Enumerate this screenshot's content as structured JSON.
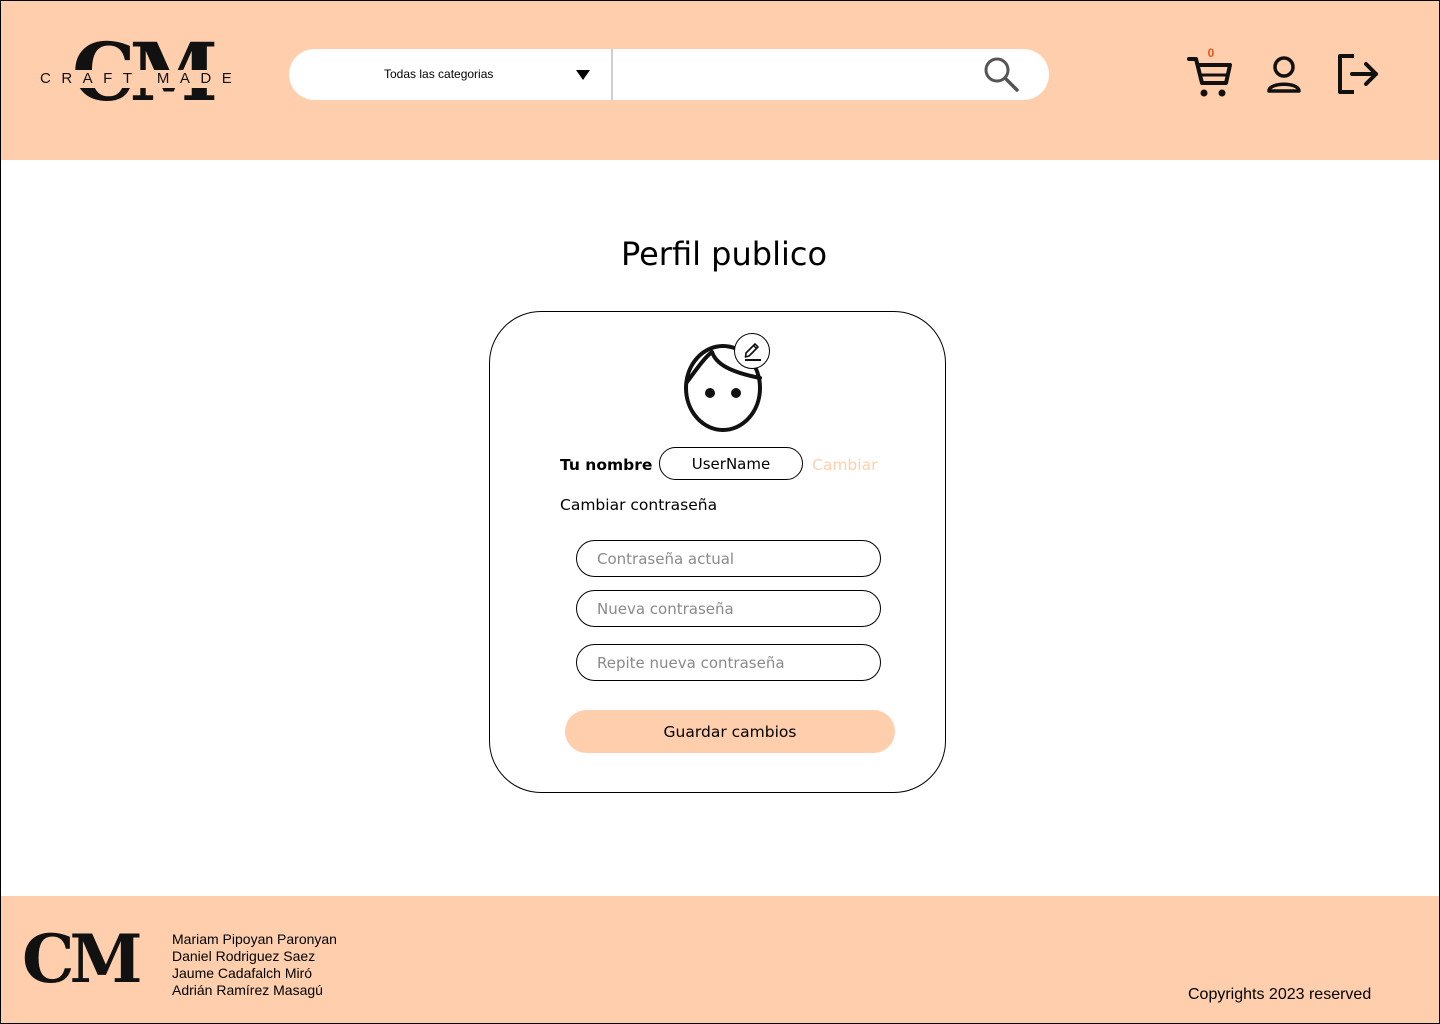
{
  "header": {
    "logo": {
      "monogram": "CM",
      "wordmark": "CRAFT MADE"
    },
    "search": {
      "category_label": "Todas las categorias",
      "placeholder": ""
    },
    "cart_count": "0",
    "icons": [
      "cart-icon",
      "user-icon",
      "logout-icon",
      "search-icon",
      "chevron-down-icon"
    ]
  },
  "main": {
    "title": "Perfil publico",
    "profile": {
      "name_label": "Tu nombre",
      "name_value": "UserName",
      "change_label": "Cambiar",
      "password_section_label": "Cambiar contraseña",
      "current_password_placeholder": "Contraseña actual",
      "new_password_placeholder": "Nueva contraseña",
      "repeat_password_placeholder": "Repite nueva contraseña",
      "save_label": "Guardar cambios"
    }
  },
  "footer": {
    "logo": "CM",
    "authors": [
      "Mariam Pipoyan Paronyan",
      "Daniel Rodriguez Saez",
      "Jaume Cadafalch Miró",
      "Adrián Ramírez Masagú"
    ],
    "copyright": "Copyrights 2023 reserved"
  },
  "colors": {
    "accent": "#ffcfad",
    "cart_badge": "#e8541a",
    "placeholder": "#8a8a8a"
  }
}
